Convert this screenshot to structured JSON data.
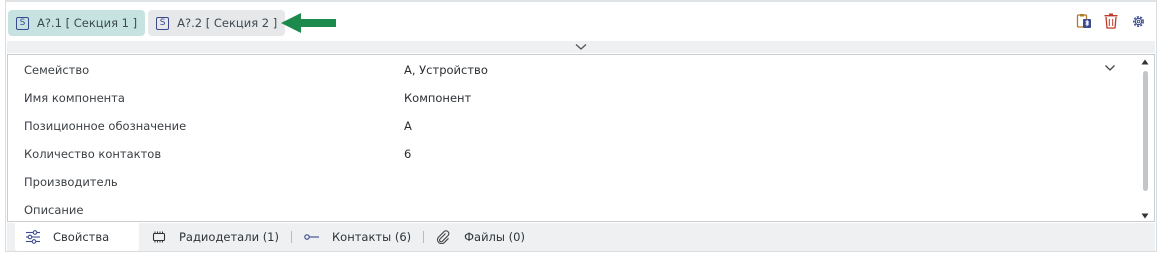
{
  "sections": [
    {
      "badge": "S",
      "label": "A?.1 [ Секция 1 ]",
      "active": true
    },
    {
      "badge": "S",
      "label": "A?.2 [ Секция 2 ]",
      "active": false
    }
  ],
  "toolbar_icons": [
    "clipboard-bluetooth-icon",
    "trash-icon",
    "gear-icon"
  ],
  "accent_colors": {
    "arrow": "#1b8a4c",
    "active_chip": "#c6e3e1",
    "trash": "#c0392b",
    "icon_blue": "#3b4a8f"
  },
  "properties": [
    {
      "label": "Семейство",
      "value": "А, Устройство",
      "dropdown": true
    },
    {
      "label": "Имя компонента",
      "value": "Компонент"
    },
    {
      "label": "Позиционное обозначение",
      "value": "A"
    },
    {
      "label": "Количество контактов",
      "value": "6"
    },
    {
      "label": "Производитель",
      "value": ""
    },
    {
      "label": "Описание",
      "value": ""
    }
  ],
  "tabs": [
    {
      "label": "Свойства",
      "icon": "sliders-icon",
      "active": true
    },
    {
      "label": "Радиодетали (1)",
      "icon": "chip-icon"
    },
    {
      "label": "Контакты (6)",
      "icon": "pin-icon"
    },
    {
      "label": "Файлы (0)",
      "icon": "paperclip-icon"
    }
  ]
}
